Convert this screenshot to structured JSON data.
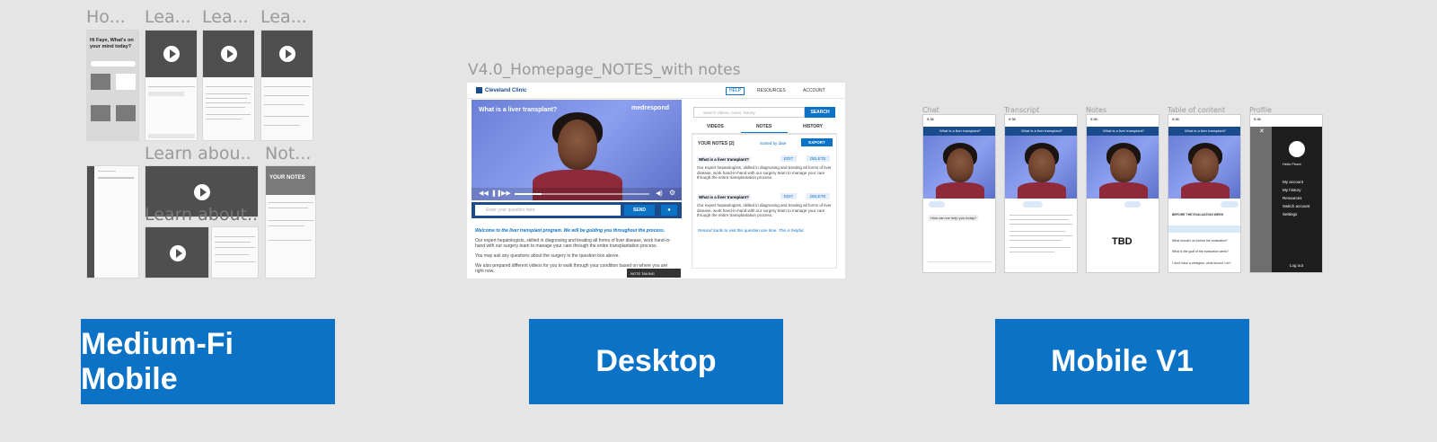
{
  "medium_fi": {
    "frame_labels": [
      "Ho...",
      "Lea...",
      "Lea...",
      "Lea...",
      "Learn abou...",
      "Not...",
      "Learn about..."
    ],
    "home_greeting": "Hi Faye, What's on your mind today?",
    "notes_title": "YOUR NOTES"
  },
  "desktop": {
    "frame_label": "V4.0_Homepage_NOTES_with notes",
    "logo": "Cleveland Clinic",
    "nav": {
      "help": "HELP",
      "resources": "RESOURCES",
      "account": "ACCOUNT"
    },
    "video_title": "What is a liver transplant?",
    "brand": "medrespond",
    "search_placeholder": "Search videos, notes, history",
    "search_button": "SEARCH",
    "tabs": [
      "VIDEOS",
      "NOTES",
      "HISTORY"
    ],
    "notes_count": "YOUR NOTES (2)",
    "sort": "Sorted by date",
    "export": "EXPORT",
    "note_question": "What is a liver transplant?",
    "edit": "EDIT",
    "delete": "DELETE",
    "note_body": "Our expert hepatologists, skilled in diagnosing and treating all forms of liver disease, work hand-in-hand with our surgery team to manage your care through the entire transplantation process.",
    "helpful_text": "Remind Sanbi to visit this question one time. This is helpful.",
    "ask_placeholder": "Enter your question here",
    "send": "SEND",
    "welcome": "Welcome to the liver transplant program. We will be guiding you throughout the process.",
    "para1": "Our expert hepatologists, skilled in diagnosing and treating all forms of liver disease, work hand-in-hand with our surgery team to manage your care through the entire transplantation process.",
    "para2": "You may ask any questions about the surgery in the question box above.",
    "para3": "We also prepared different videos for you to walk through your condition based on where you are right now.",
    "note_taking": "NOTE TAKING"
  },
  "mobile_v1": {
    "labels": [
      "Chat",
      "Transcript",
      "Notes",
      "Table of content",
      "Profile"
    ],
    "status_time": "9:36",
    "video_title": "What is a liver transplant?",
    "tbd": "TBD",
    "chat_question": "How can we help you today?",
    "profile_name": "Hello Phore",
    "profile_menu": [
      "My account",
      "My history",
      "Resources",
      "Switch account",
      "Settings"
    ],
    "logout": "Log out",
    "toc_items": [
      "BEFORE THE EVALUATION WEEK",
      "What should I do before the evaluation?",
      "What is the goal of the evaluation week?",
      "I don't have a caregiver, what should I do?"
    ]
  },
  "buttons": {
    "medium_fi": "Medium-Fi Mobile",
    "desktop": "Desktop",
    "mobile_v1": "Mobile V1"
  },
  "colors": {
    "accent": "#0b72c6",
    "background": "#e5e5e5"
  }
}
